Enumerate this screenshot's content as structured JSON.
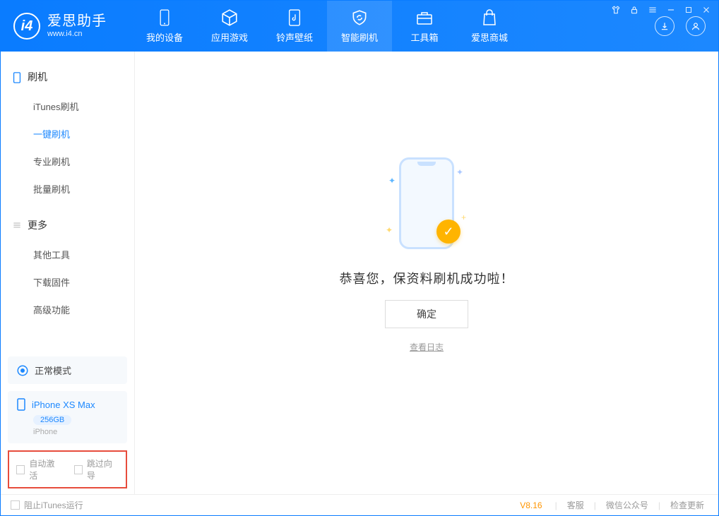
{
  "app": {
    "name": "爱思助手",
    "domain": "www.i4.cn"
  },
  "nav": {
    "items": [
      {
        "label": "我的设备"
      },
      {
        "label": "应用游戏"
      },
      {
        "label": "铃声壁纸"
      },
      {
        "label": "智能刷机"
      },
      {
        "label": "工具箱"
      },
      {
        "label": "爱思商城"
      }
    ]
  },
  "sidebar": {
    "group1": {
      "title": "刷机",
      "items": [
        "iTunes刷机",
        "一键刷机",
        "专业刷机",
        "批量刷机"
      ]
    },
    "group2": {
      "title": "更多",
      "items": [
        "其他工具",
        "下载固件",
        "高级功能"
      ]
    },
    "mode": "正常模式",
    "device": {
      "name": "iPhone XS Max",
      "capacity": "256GB",
      "type": "iPhone"
    },
    "checks": {
      "auto_activate": "自动激活",
      "skip_guide": "跳过向导"
    }
  },
  "main": {
    "success": "恭喜您，保资料刷机成功啦！",
    "ok": "确定",
    "view_log": "查看日志"
  },
  "status": {
    "block_itunes": "阻止iTunes运行",
    "version": "V8.16",
    "links": [
      "客服",
      "微信公众号",
      "检查更新"
    ]
  }
}
